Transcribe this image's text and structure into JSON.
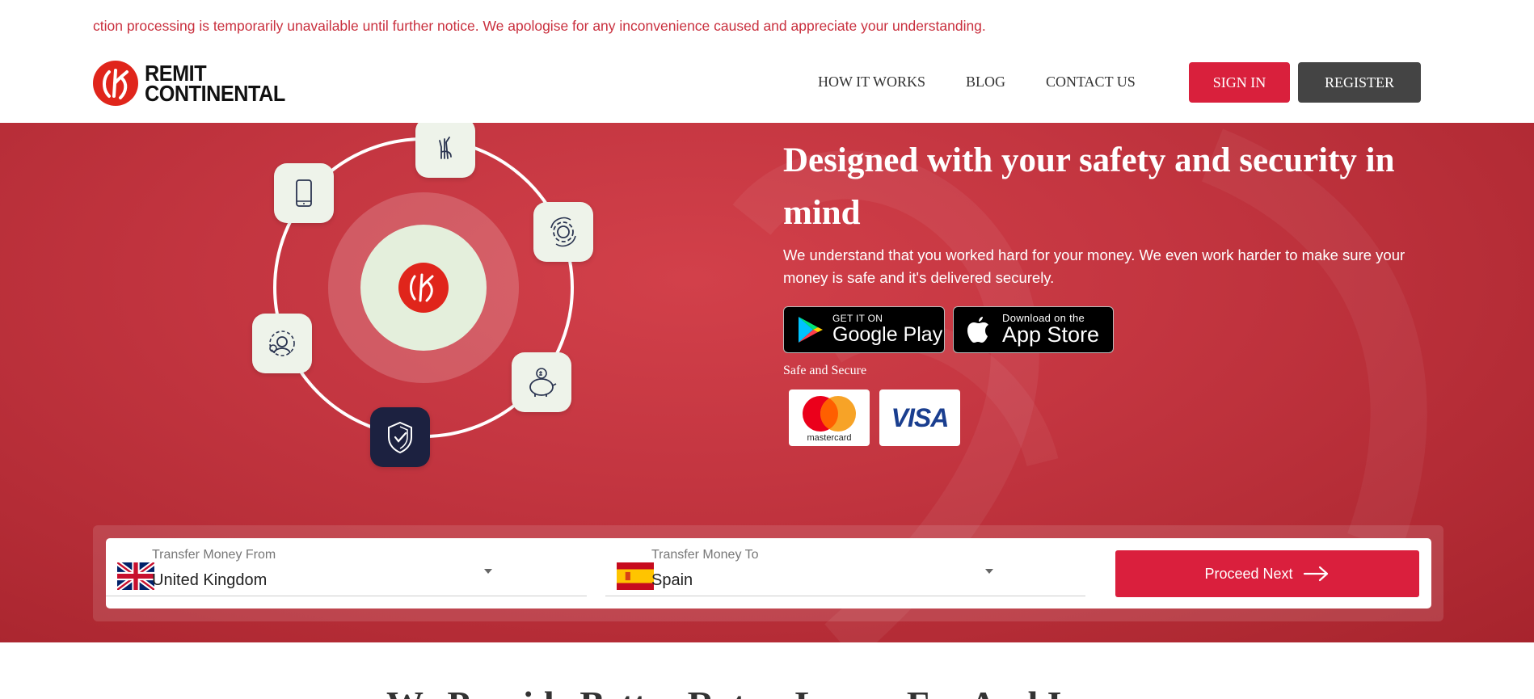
{
  "notice": {
    "text": "ction processing is temporarily unavailable until further notice. We apologise for any inconvenience caused and appreciate your understanding."
  },
  "brand": {
    "line1": "REMIT",
    "line2": "CONTINENTAL",
    "color": "#e0251b"
  },
  "nav": {
    "items": [
      {
        "label": "HOW IT WORKS"
      },
      {
        "label": "BLOG"
      },
      {
        "label": "CONTACT US"
      }
    ],
    "sign_in": "SIGN IN",
    "register": "REGISTER"
  },
  "hero": {
    "title": "Designed with your safety and security in mind",
    "subtitle": "We understand that you worked hard for your money. We even work harder to make sure your money is safe and it's delivered securely.",
    "google_play": {
      "small": "GET IT ON",
      "big": "Google Play"
    },
    "app_store": {
      "small": "Download on the",
      "big": "App Store"
    },
    "safe_label": "Safe and Secure",
    "cards": {
      "mastercard": "mastercard",
      "visa": "VISA"
    },
    "orbit_icons": [
      "fingers-crossed-icon",
      "phone-icon",
      "gear-cycle-icon",
      "support-gear-icon",
      "piggy-bank-icon",
      "shield-check-icon"
    ]
  },
  "transfer": {
    "from_label": "Transfer Money From",
    "from_value": "United Kingdom",
    "to_label": "Transfer Money To",
    "to_value": "Spain",
    "proceed": "Proceed Next"
  },
  "section": {
    "title_partial": "We Provide Better Rates, Lower Fee And Improv"
  },
  "colors": {
    "accent": "#d9203c",
    "hero_bg": "#c33540",
    "dark_button": "#444444"
  }
}
